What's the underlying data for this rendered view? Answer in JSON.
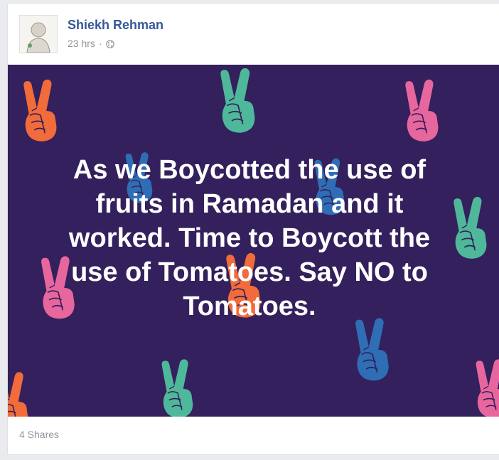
{
  "post": {
    "author": "Shiekh Rehman",
    "time": "23 hrs",
    "separator": "·",
    "privacy_icon": "globe-icon",
    "text": "As we Boycotted the use of fruits in Ramadan and it worked. Time to Boycott the use of Tomatoes. Say NO to Tomatoes.",
    "background_color": "#33205c",
    "shares": "4 Shares"
  },
  "colors": {
    "link": "#365899",
    "meta": "#90949c",
    "hand_palette": [
      "#f26b3a",
      "#4fb89a",
      "#e8669e",
      "#2f6db5"
    ]
  }
}
